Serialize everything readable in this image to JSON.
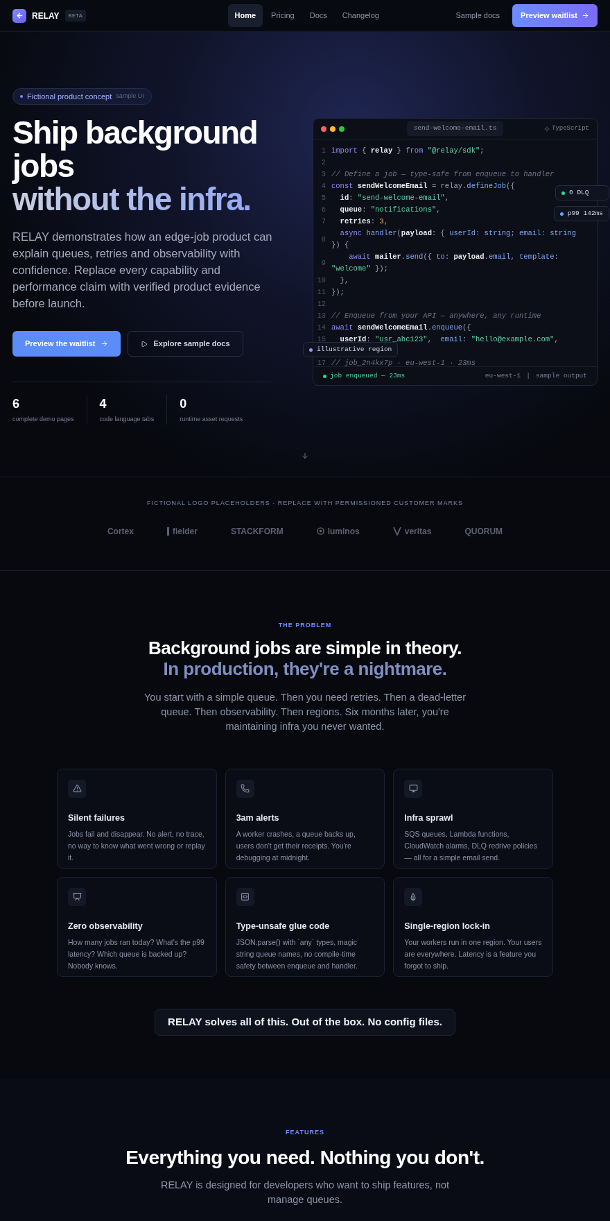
{
  "nav": {
    "logo_text": "RELAY",
    "beta": "BETA",
    "links": [
      {
        "label": "Home",
        "selected": true
      },
      {
        "label": "Pricing",
        "selected": false
      },
      {
        "label": "Docs",
        "selected": false
      },
      {
        "label": "Changelog",
        "selected": false
      }
    ],
    "secondary_link": "Sample docs",
    "cta": "Preview waitlist"
  },
  "hero": {
    "badge": {
      "label": "Fictional product concept",
      "note": "sample UI"
    },
    "title_lines": [
      {
        "text": "Ship background jobs",
        "kind": "plain"
      },
      {
        "text": "without the infra.",
        "kind": "gradient"
      }
    ],
    "description": "RELAY demonstrates how an edge-job product can explain queues, retries and observability with confidence. Replace every capability and performance claim with verified product evidence before launch.",
    "primary_button": "Preview the waitlist",
    "secondary_button": "Explore sample docs",
    "stats": [
      {
        "value": "6",
        "label": "complete demo pages"
      },
      {
        "value": "4",
        "label": "code language tabs"
      },
      {
        "value": "0",
        "label": "runtime asset requests"
      }
    ],
    "code_card": {
      "filename": "send-welcome-email.ts",
      "language": "TypeScript",
      "lines": [
        {
          "number": "1",
          "tokens": [
            {
              "text": "import",
              "kind": "keyword"
            },
            {
              "text": " { ",
              "kind": "punct"
            },
            {
              "text": "relay",
              "kind": "ident"
            },
            {
              "text": " } ",
              "kind": "punct"
            },
            {
              "text": "from ",
              "kind": "keyword"
            },
            {
              "text": "\"@relay/sdk\"",
              "kind": "string"
            },
            {
              "text": ";",
              "kind": "punct"
            }
          ]
        },
        {
          "number": "2"
        },
        {
          "number": "3",
          "tokens": [
            {
              "text": "// Define a job — type-safe from enqueue to handler",
              "kind": "comment"
            }
          ]
        },
        {
          "number": "4",
          "tokens": [
            {
              "text": "const ",
              "kind": "keyword"
            },
            {
              "text": "sendWelcomeEmail",
              "kind": "ident"
            },
            {
              "text": " = relay.",
              "kind": "punct"
            },
            {
              "text": "defineJob",
              "kind": "fn"
            },
            {
              "text": "({",
              "kind": "punct"
            }
          ]
        },
        {
          "number": "5",
          "tokens": [
            {
              "text": "  id",
              "kind": "ident"
            },
            {
              "text": ": ",
              "kind": "punct"
            },
            {
              "text": "\"send-welcome-email\"",
              "kind": "string"
            },
            {
              "text": ",",
              "kind": "punct"
            }
          ]
        },
        {
          "number": "6",
          "tokens": [
            {
              "text": "  queue",
              "kind": "ident"
            },
            {
              "text": ": ",
              "kind": "punct"
            },
            {
              "text": "\"notifications\"",
              "kind": "string"
            },
            {
              "text": ",",
              "kind": "punct"
            }
          ]
        },
        {
          "number": "7",
          "tokens": [
            {
              "text": "  retries",
              "kind": "ident"
            },
            {
              "text": ": ",
              "kind": "punct"
            },
            {
              "text": "3",
              "kind": "number"
            },
            {
              "text": ",",
              "kind": "punct"
            }
          ]
        },
        {
          "number": "8",
          "tokens": [
            {
              "text": "  async ",
              "kind": "keyword"
            },
            {
              "text": "handler",
              "kind": "fn"
            },
            {
              "text": "(",
              "kind": "punct"
            },
            {
              "text": "payload",
              "kind": "ident"
            },
            {
              "text": ": { ",
              "kind": "punct"
            },
            {
              "text": "userId",
              "kind": "fn"
            },
            {
              "text": ": ",
              "kind": "punct"
            },
            {
              "text": "string",
              "kind": "fn"
            },
            {
              "text": "; ",
              "kind": "punct"
            },
            {
              "text": "email",
              "kind": "fn"
            },
            {
              "text": ": ",
              "kind": "punct"
            },
            {
              "text": "string",
              "kind": "fn"
            },
            {
              "text": " }) {",
              "kind": "punct"
            }
          ]
        },
        {
          "number": "9",
          "tokens": [
            {
              "text": "    await ",
              "kind": "keyword"
            },
            {
              "text": "mailer",
              "kind": "ident"
            },
            {
              "text": ".",
              "kind": "punct"
            },
            {
              "text": "send",
              "kind": "fn"
            },
            {
              "text": "({ ",
              "kind": "punct"
            },
            {
              "text": "to",
              "kind": "fn"
            },
            {
              "text": ": ",
              "kind": "punct"
            },
            {
              "text": "payload",
              "kind": "ident"
            },
            {
              "text": ".",
              "kind": "punct"
            },
            {
              "text": "email",
              "kind": "fn"
            },
            {
              "text": ", ",
              "kind": "punct"
            },
            {
              "text": "template",
              "kind": "fn"
            },
            {
              "text": ": ",
              "kind": "punct"
            },
            {
              "text": "\"welcome\"",
              "kind": "string"
            },
            {
              "text": " });",
              "kind": "punct"
            }
          ]
        },
        {
          "number": "10",
          "tokens": [
            {
              "text": "  },",
              "kind": "punct"
            }
          ]
        },
        {
          "number": "11",
          "tokens": [
            {
              "text": "});",
              "kind": "punct"
            }
          ]
        },
        {
          "number": "12"
        },
        {
          "number": "13",
          "tokens": [
            {
              "text": "// Enqueue from your API — anywhere, any runtime",
              "kind": "comment"
            }
          ]
        },
        {
          "number": "14",
          "tokens": [
            {
              "text": "await ",
              "kind": "keyword"
            },
            {
              "text": "sendWelcomeEmail",
              "kind": "ident"
            },
            {
              "text": ".",
              "kind": "punct"
            },
            {
              "text": "enqueue",
              "kind": "fn"
            },
            {
              "text": "({",
              "kind": "punct"
            }
          ]
        },
        {
          "number": "15",
          "tokens": [
            {
              "text": "  userId",
              "kind": "ident"
            },
            {
              "text": ": ",
              "kind": "punct"
            },
            {
              "text": "\"usr_abc123\"",
              "kind": "string"
            },
            {
              "text": ",  ",
              "kind": "punct"
            },
            {
              "text": "email",
              "kind": "fn"
            },
            {
              "text": ": ",
              "kind": "punct"
            },
            {
              "text": "\"hello@example.com\"",
              "kind": "string"
            },
            {
              "text": ",",
              "kind": "punct"
            }
          ]
        },
        {
          "number": "17",
          "tokens": [
            {
              "text": "// job_2n4kx7p · eu-west-1 · 23ms",
              "kind": "comment"
            }
          ]
        }
      ],
      "status": "job enqueued — 23ms",
      "region": "eu-west-1",
      "separator": "|",
      "output_note": "sample output",
      "floating_badges": [
        {
          "label": "0 DLQ",
          "color": "#34d399"
        },
        {
          "label": "p99 142ms",
          "color": "#60a5fa"
        },
        {
          "label": "illustrative region",
          "color": "#a78bfa"
        }
      ]
    }
  },
  "logos": {
    "caption": "FICTIONAL LOGO PLACEHOLDERS · REPLACE WITH PERMISSIONED CUSTOMER MARKS",
    "items": [
      {
        "name": "Cortex",
        "kind": "text"
      },
      {
        "name": "fielder",
        "kind": "bar"
      },
      {
        "name": "STACKFORM",
        "kind": "text"
      },
      {
        "name": "luminos",
        "kind": "ring"
      },
      {
        "name": "veritas",
        "kind": "vee"
      },
      {
        "name": "QUORUM",
        "kind": "text"
      }
    ]
  },
  "problem": {
    "eyebrow": "THE PROBLEM",
    "heading_lines": [
      "Background jobs are simple in theory.",
      "In production, they're a nightmare."
    ],
    "description": "You start with a simple queue. Then you need retries. Then a dead-letter queue. Then observability. Then regions. Six months later, you're maintaining infra you never wanted.",
    "cards": [
      {
        "title": "Silent failures",
        "text": "Jobs fail and disappear. No alert, no trace, no way to know what went wrong or replay it."
      },
      {
        "title": "3am alerts",
        "text": "A worker crashes, a queue backs up, users don't get their receipts. You're debugging at midnight."
      },
      {
        "title": "Infra sprawl",
        "text": "SQS queues, Lambda functions, CloudWatch alarms, DLQ redrive policies — all for a simple email send."
      },
      {
        "title": "Zero observability",
        "text": "How many jobs ran today? What's the p99 latency? Which queue is backed up? Nobody knows."
      },
      {
        "title": "Type-unsafe glue code",
        "text": "JSON.parse() with `any` types, magic string queue names, no compile-time safety between enqueue and handler."
      },
      {
        "title": "Single-region lock-in",
        "text": "Your workers run in one region. Your users are everywhere. Latency is a feature you forgot to ship."
      }
    ],
    "callout": "RELAY solves all of this. Out of the box. No config files."
  },
  "features": {
    "eyebrow": "FEATURES",
    "heading": "Everything you need. Nothing you don't.",
    "description": "RELAY is designed for developers who want to ship features, not manage queues."
  }
}
